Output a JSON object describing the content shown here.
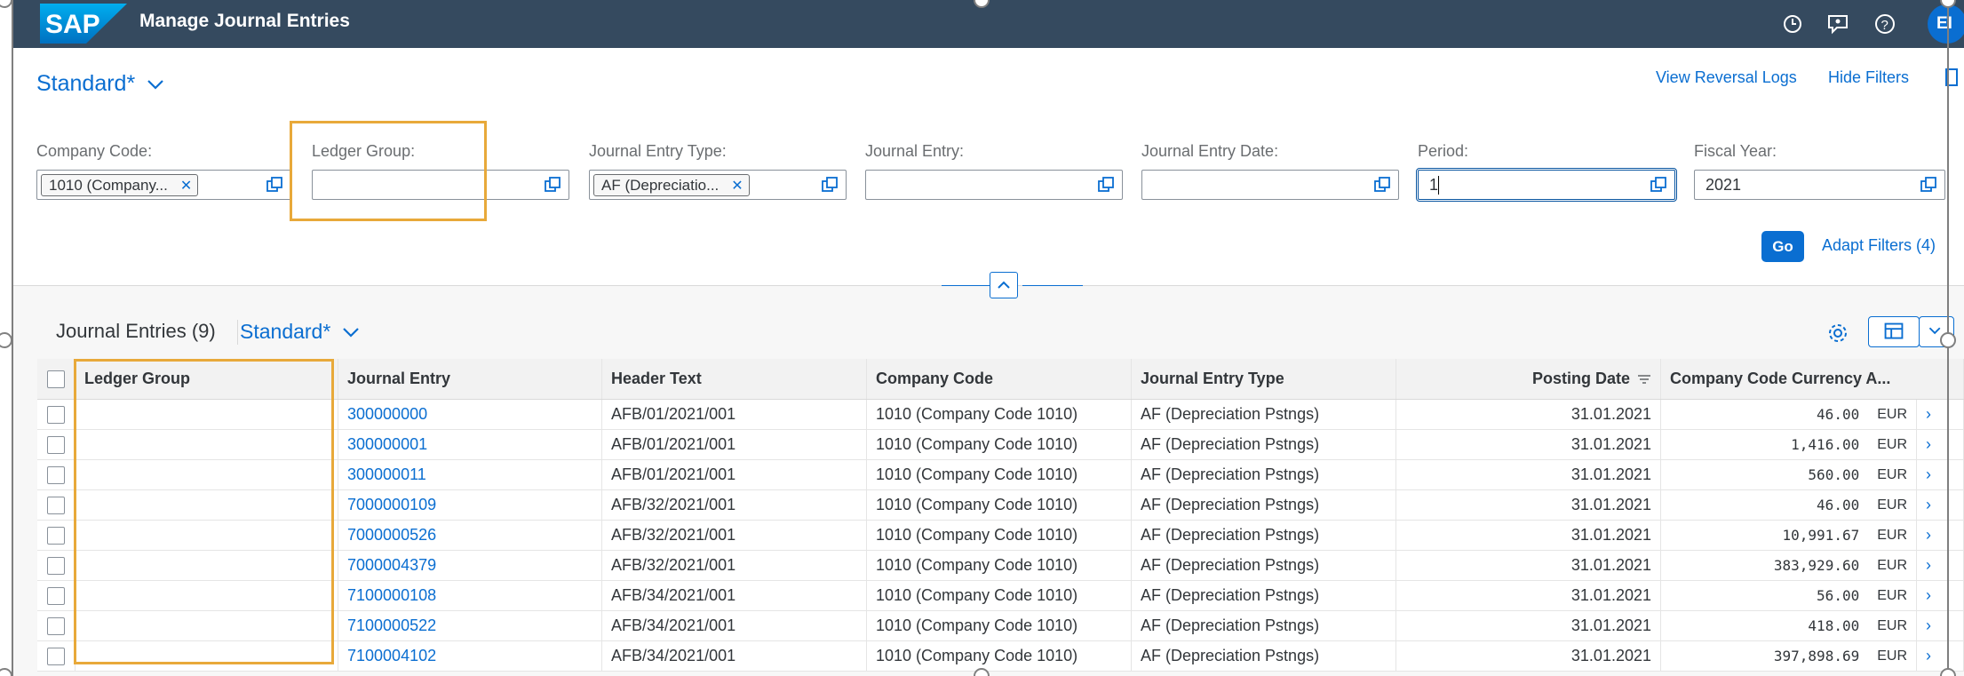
{
  "shell": {
    "logo": "SAP",
    "app_title": "Manage Journal Entries",
    "avatar_initials": "EI",
    "icons": [
      "history-icon",
      "feedback-icon",
      "help-icon"
    ]
  },
  "header": {
    "variant_label": "Standard*",
    "view_reversal_logs": "View Reversal Logs",
    "hide_filters": "Hide Filters"
  },
  "filters": [
    {
      "label": "Company Code:",
      "token": "1010 (Company...",
      "value": ""
    },
    {
      "label": "Ledger Group:",
      "token": "",
      "value": ""
    },
    {
      "label": "Journal Entry Type:",
      "token": "AF (Depreciatio...",
      "value": ""
    },
    {
      "label": "Journal Entry:",
      "token": "",
      "value": ""
    },
    {
      "label": "Journal Entry Date:",
      "token": "",
      "value": ""
    },
    {
      "label": "Period:",
      "token": "",
      "value": "1"
    },
    {
      "label": "Fiscal Year:",
      "token": "",
      "value": "2021"
    }
  ],
  "go_label": "Go",
  "adapt_filters_label": "Adapt Filters (4)",
  "table": {
    "title": "Journal Entries (9)",
    "variant_label": "Standard*",
    "columns": [
      "Ledger Group",
      "Journal Entry",
      "Header Text",
      "Company Code",
      "Journal Entry Type",
      "Posting Date",
      "Company Code Currency A..."
    ],
    "rows": [
      {
        "ledger_group": "",
        "journal_entry": "300000000",
        "header_text": "AFB/01/2021/001",
        "company_code": "1010 (Company Code 1010)",
        "je_type": "AF (Depreciation Pstngs)",
        "posting_date": "31.01.2021",
        "amount": "46.00",
        "currency": "EUR"
      },
      {
        "ledger_group": "",
        "journal_entry": "300000001",
        "header_text": "AFB/01/2021/001",
        "company_code": "1010 (Company Code 1010)",
        "je_type": "AF (Depreciation Pstngs)",
        "posting_date": "31.01.2021",
        "amount": "1,416.00",
        "currency": "EUR"
      },
      {
        "ledger_group": "",
        "journal_entry": "300000011",
        "header_text": "AFB/01/2021/001",
        "company_code": "1010 (Company Code 1010)",
        "je_type": "AF (Depreciation Pstngs)",
        "posting_date": "31.01.2021",
        "amount": "560.00",
        "currency": "EUR"
      },
      {
        "ledger_group": "",
        "journal_entry": "7000000109",
        "header_text": "AFB/32/2021/001",
        "company_code": "1010 (Company Code 1010)",
        "je_type": "AF (Depreciation Pstngs)",
        "posting_date": "31.01.2021",
        "amount": "46.00",
        "currency": "EUR"
      },
      {
        "ledger_group": "",
        "journal_entry": "7000000526",
        "header_text": "AFB/32/2021/001",
        "company_code": "1010 (Company Code 1010)",
        "je_type": "AF (Depreciation Pstngs)",
        "posting_date": "31.01.2021",
        "amount": "10,991.67",
        "currency": "EUR"
      },
      {
        "ledger_group": "",
        "journal_entry": "7000004379",
        "header_text": "AFB/32/2021/001",
        "company_code": "1010 (Company Code 1010)",
        "je_type": "AF (Depreciation Pstngs)",
        "posting_date": "31.01.2021",
        "amount": "383,929.60",
        "currency": "EUR"
      },
      {
        "ledger_group": "",
        "journal_entry": "7100000108",
        "header_text": "AFB/34/2021/001",
        "company_code": "1010 (Company Code 1010)",
        "je_type": "AF (Depreciation Pstngs)",
        "posting_date": "31.01.2021",
        "amount": "56.00",
        "currency": "EUR"
      },
      {
        "ledger_group": "",
        "journal_entry": "7100000522",
        "header_text": "AFB/34/2021/001",
        "company_code": "1010 (Company Code 1010)",
        "je_type": "AF (Depreciation Pstngs)",
        "posting_date": "31.01.2021",
        "amount": "418.00",
        "currency": "EUR"
      },
      {
        "ledger_group": "",
        "journal_entry": "7100004102",
        "header_text": "AFB/34/2021/001",
        "company_code": "1010 (Company Code 1010)",
        "je_type": "AF (Depreciation Pstngs)",
        "posting_date": "31.01.2021",
        "amount": "397,898.69",
        "currency": "EUR"
      }
    ]
  },
  "colors": {
    "shell_bg": "#354a5f",
    "accent": "#0a6ed1",
    "highlight": "#e8a93a"
  }
}
